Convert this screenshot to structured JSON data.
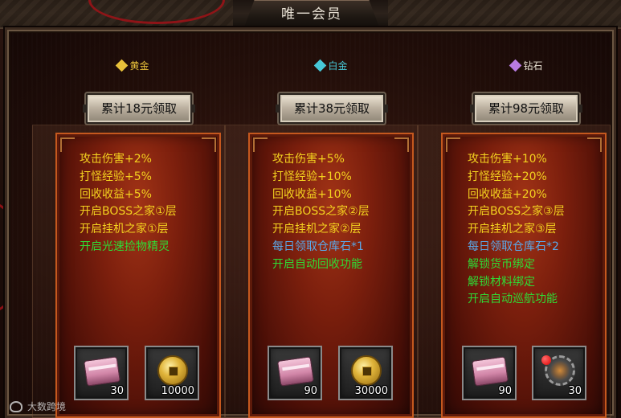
{
  "window": {
    "title": "唯一会员"
  },
  "tiers": [
    {
      "name": "黄金",
      "gem_color": "#e8c13a",
      "label_color": "#e8c13a",
      "claim_label": "累计18元领取",
      "benefits": [
        {
          "text": "攻击伤害+2%",
          "color": "gold"
        },
        {
          "text": "打怪经验+5%",
          "color": "gold"
        },
        {
          "text": "回收收益+5%",
          "color": "gold"
        },
        {
          "text": "开启BOSS之家①层",
          "color": "gold"
        },
        {
          "text": "开启挂机之家①层",
          "color": "gold"
        },
        {
          "text": "开启光速捡物精灵",
          "color": "green"
        }
      ],
      "rewards": [
        {
          "icon": "pink-chest-icon",
          "qty": "30"
        },
        {
          "icon": "gold-coin-icon",
          "qty": "10000"
        }
      ]
    },
    {
      "name": "白金",
      "gem_color": "#47c8d8",
      "label_color": "#47c8d8",
      "claim_label": "累计38元领取",
      "benefits": [
        {
          "text": "攻击伤害+5%",
          "color": "gold"
        },
        {
          "text": "打怪经验+10%",
          "color": "gold"
        },
        {
          "text": "回收收益+10%",
          "color": "gold"
        },
        {
          "text": "开启BOSS之家②层",
          "color": "gold"
        },
        {
          "text": "开启挂机之家②层",
          "color": "gold"
        },
        {
          "text": "每日领取仓库石*1",
          "color": "blue"
        },
        {
          "text": "开启自动回收功能",
          "color": "green"
        }
      ],
      "rewards": [
        {
          "icon": "pink-chest-icon",
          "qty": "90"
        },
        {
          "icon": "gold-coin-icon",
          "qty": "30000"
        }
      ]
    },
    {
      "name": "钻石",
      "gem_color": "#b77be0",
      "label_color": "#e6dfd0",
      "claim_label": "累计98元领取",
      "benefits": [
        {
          "text": "攻击伤害+10%",
          "color": "gold"
        },
        {
          "text": "打怪经验+20%",
          "color": "gold"
        },
        {
          "text": "回收收益+20%",
          "color": "gold"
        },
        {
          "text": "开启BOSS之家③层",
          "color": "gold"
        },
        {
          "text": "开启挂机之家③层",
          "color": "gold"
        },
        {
          "text": "每日领取仓库石*2",
          "color": "blue"
        },
        {
          "text": "解锁货币绑定",
          "color": "green"
        },
        {
          "text": "解锁材料绑定",
          "color": "green"
        },
        {
          "text": "开启自动巡航功能",
          "color": "green"
        }
      ],
      "rewards": [
        {
          "icon": "pink-chest-icon",
          "qty": "90"
        },
        {
          "icon": "gear-orb-icon",
          "qty": "30"
        }
      ]
    }
  ],
  "watermark": "大数跨境"
}
